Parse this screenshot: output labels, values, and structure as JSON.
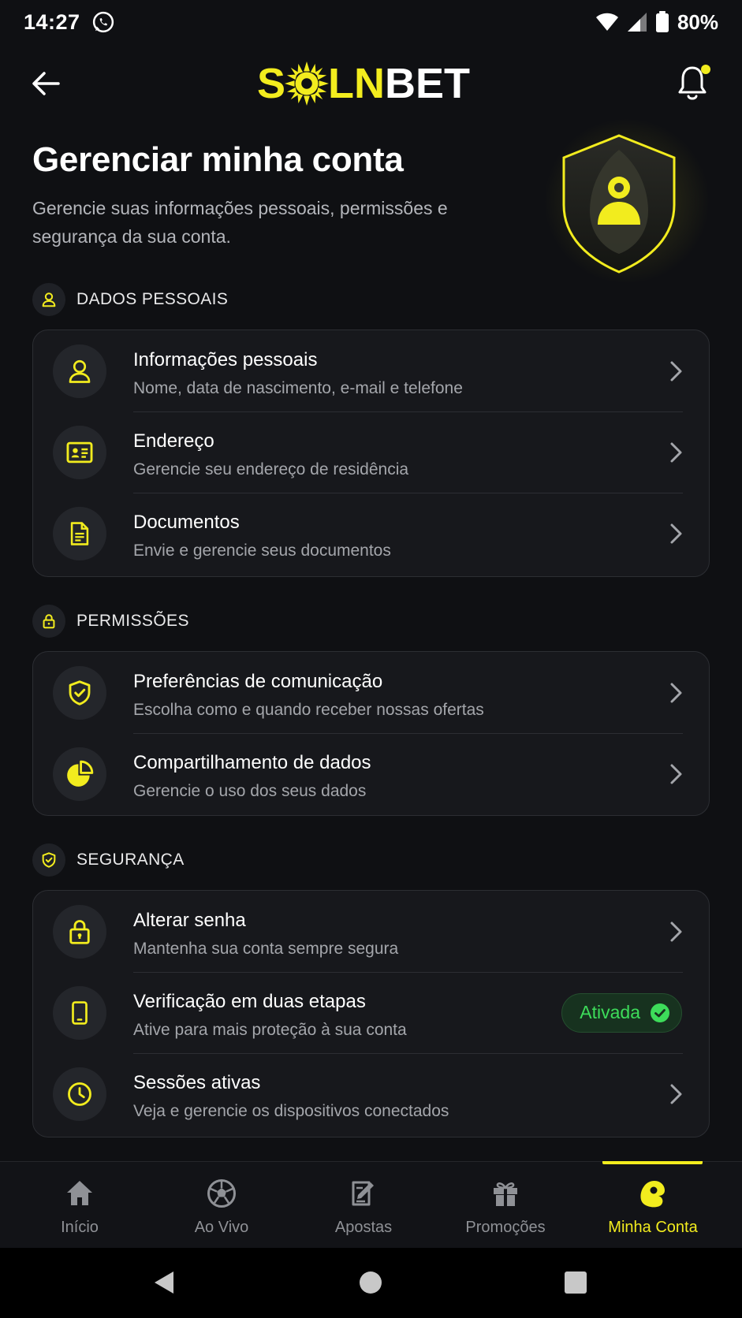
{
  "status_bar": {
    "time": "14:27",
    "battery": "80%"
  },
  "header": {
    "logo_part1": "S",
    "logo_part2": "LN",
    "logo_part3": "BET"
  },
  "intro": {
    "title": "Gerenciar minha conta",
    "subtitle": "Gerencie suas informações pessoais, permissões e segurança da sua conta."
  },
  "sections": {
    "personal": {
      "label": "DADOS PESSOAIS",
      "items": [
        {
          "title": "Informações pessoais",
          "desc": "Nome, data de nascimento, e-mail e telefone",
          "icon": "user-icon"
        },
        {
          "title": "Endereço",
          "desc": "Gerencie seu endereço de residência",
          "icon": "id-card-icon"
        },
        {
          "title": "Documentos",
          "desc": "Envie e gerencie seus documentos",
          "icon": "document-icon"
        }
      ]
    },
    "permissions": {
      "label": "PERMISSÕES",
      "items": [
        {
          "title": "Preferências de comunicação",
          "desc": "Escolha como e quando receber nossas ofertas",
          "icon": "shield-check-icon"
        },
        {
          "title": "Compartilhamento de dados",
          "desc": "Gerencie o uso dos seus dados",
          "icon": "pie-chart-icon"
        }
      ]
    },
    "security": {
      "label": "SEGURANÇA",
      "items": [
        {
          "title": "Alterar senha",
          "desc": "Mantenha sua conta sempre segura",
          "icon": "lock-icon"
        },
        {
          "title": "Verificação em duas etapas",
          "desc": "Ative para mais proteção à sua conta",
          "icon": "phone-icon",
          "badge": "Ativada"
        },
        {
          "title": "Sessões ativas",
          "desc": "Veja e gerencie os dispositivos conectados",
          "icon": "clock-icon"
        }
      ]
    }
  },
  "bottom_nav": {
    "items": [
      {
        "label": "Início",
        "icon": "home-icon"
      },
      {
        "label": "Ao Vivo",
        "icon": "soccer-ball-icon"
      },
      {
        "label": "Apostas",
        "icon": "bet-slip-icon"
      },
      {
        "label": "Promoções",
        "icon": "gift-icon"
      },
      {
        "label": "Minha Conta",
        "icon": "account-icon",
        "active": true
      }
    ]
  },
  "colors": {
    "accent": "#f2ec1e",
    "background": "#0f1013",
    "card": "#17181c",
    "success": "#3ddc5a"
  }
}
